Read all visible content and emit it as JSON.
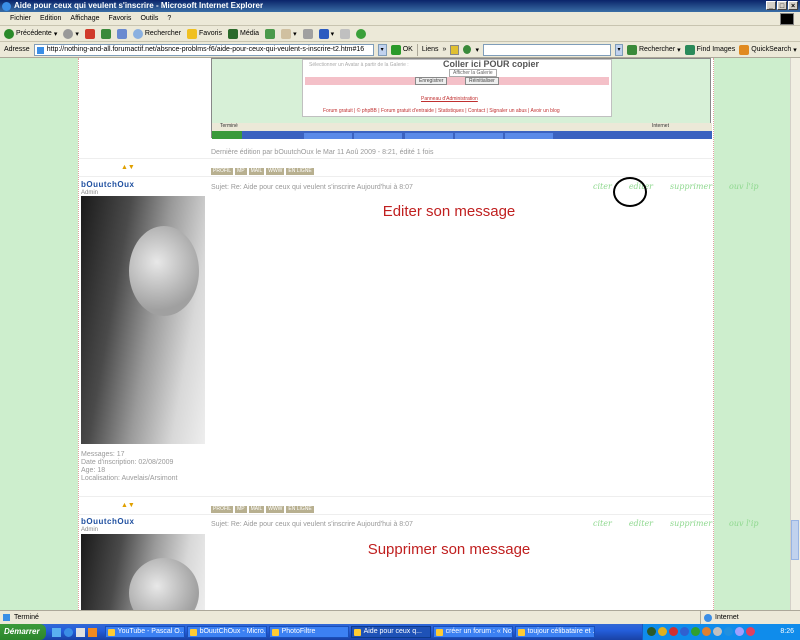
{
  "window": {
    "title": "Aide pour ceux qui veulent s'inscrire - Microsoft Internet Explorer"
  },
  "menu": [
    "Fichier",
    "Edition",
    "Affichage",
    "Favoris",
    "Outils",
    "?"
  ],
  "toolbar": {
    "back": "Précédente",
    "search": "Rechercher",
    "favorites": "Favoris",
    "media": "Média"
  },
  "address": {
    "label": "Adresse",
    "url": "http://nothing-and-all.forumactif.net/absnce-problms-f6/aide-pour-ceux-qui-veulent-s-inscrire-t2.htm#16",
    "go": "OK",
    "links": "Liens",
    "search_btn": "Rechercher",
    "find_images": "Find Images",
    "quicksearch": "QuickSearch"
  },
  "inset": {
    "heading": "Coller ici POUR copier",
    "line1": "Sélectionner un Avatar à partir de la Galerie :",
    "btn_gallery": "Afficher la Galerie",
    "btn_save": "Enregistrer",
    "btn_reset": "Réinitialiser",
    "admin": "Panneau d'Administration",
    "footer": "Forum gratuit | © phpBB | Forum gratuit d'entraide | Statistiques | Contact | Signaler un abus | Avoir un blog",
    "mini_status": "Terminé",
    "mini_net": "Internet"
  },
  "edit_note": "Dernière édition par bOuutchOux le Mar 11 Aoû 2009 - 8:21, édité 1 fois",
  "profile_pills": [
    "PROFIL",
    "MP",
    "MAIL",
    "WWW",
    "EN LIGNE"
  ],
  "posts": [
    {
      "user": "bOuutchOux",
      "rank": "Admin",
      "subject": "Sujet: Re: Aide pour ceux qui veulent s'inscrire   Aujourd'hui à 8:07",
      "actions": [
        "citer",
        "editer",
        "supprimer",
        "ouv l'ip"
      ],
      "note": "Editer son message",
      "stats": [
        "Messages: 17",
        "Date d'inscription: 02/08/2009",
        "Age: 18",
        "Localisation: Auvelais/Arsimont"
      ]
    },
    {
      "user": "bOuutchOux",
      "rank": "Admin",
      "subject": "Sujet: Re: Aide pour ceux qui veulent s'inscrire   Aujourd'hui à 8:07",
      "actions": [
        "citer",
        "editer",
        "supprimer",
        "ouv l'ip"
      ],
      "note": "Supprimer son message"
    }
  ],
  "status": {
    "text": "Terminé",
    "zone": "Internet"
  },
  "taskbar": {
    "start": "Démarrer",
    "tasks": [
      "YouTube - Pascal O...",
      "bOuutChOux - Micro...",
      "PhotoFiltre",
      "Aide pour ceux q...",
      "créer un forum : « No...",
      "toujour célibataire et ..."
    ],
    "clock": "8:26"
  }
}
